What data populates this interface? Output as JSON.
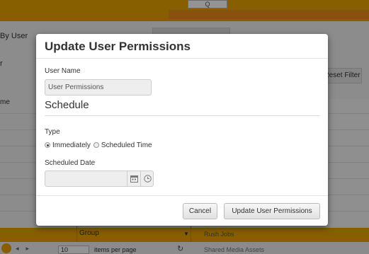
{
  "background": {
    "search_label": "Q",
    "by_user_label": "By User",
    "r_label": "r",
    "reset_filter_label": "Reset Filter",
    "name_col_label": "me",
    "group_label": "Group",
    "rush_jobs_label": "Rush Jobs",
    "page_size_value": "10",
    "per_page_label": "items per page",
    "shared_media_label": "Shared Media Assets"
  },
  "modal": {
    "title": "Update User Permissions",
    "user_name_label": "User Name",
    "user_name_value": "User Permissions",
    "schedule_heading": "Schedule",
    "type_label": "Type",
    "type_options": [
      {
        "label": "Immediately",
        "checked": true
      },
      {
        "label": "Scheduled Time",
        "checked": false
      }
    ],
    "scheduled_date_label": "Scheduled Date",
    "scheduled_date_value": "",
    "icons": {
      "calendar": "calendar-icon",
      "clock": "clock-icon"
    },
    "cancel_label": "Cancel",
    "submit_label": "Update User Permissions"
  },
  "colors": {
    "accent": "#e8a200",
    "overlay": "rgba(0,0,0,0.42)"
  }
}
